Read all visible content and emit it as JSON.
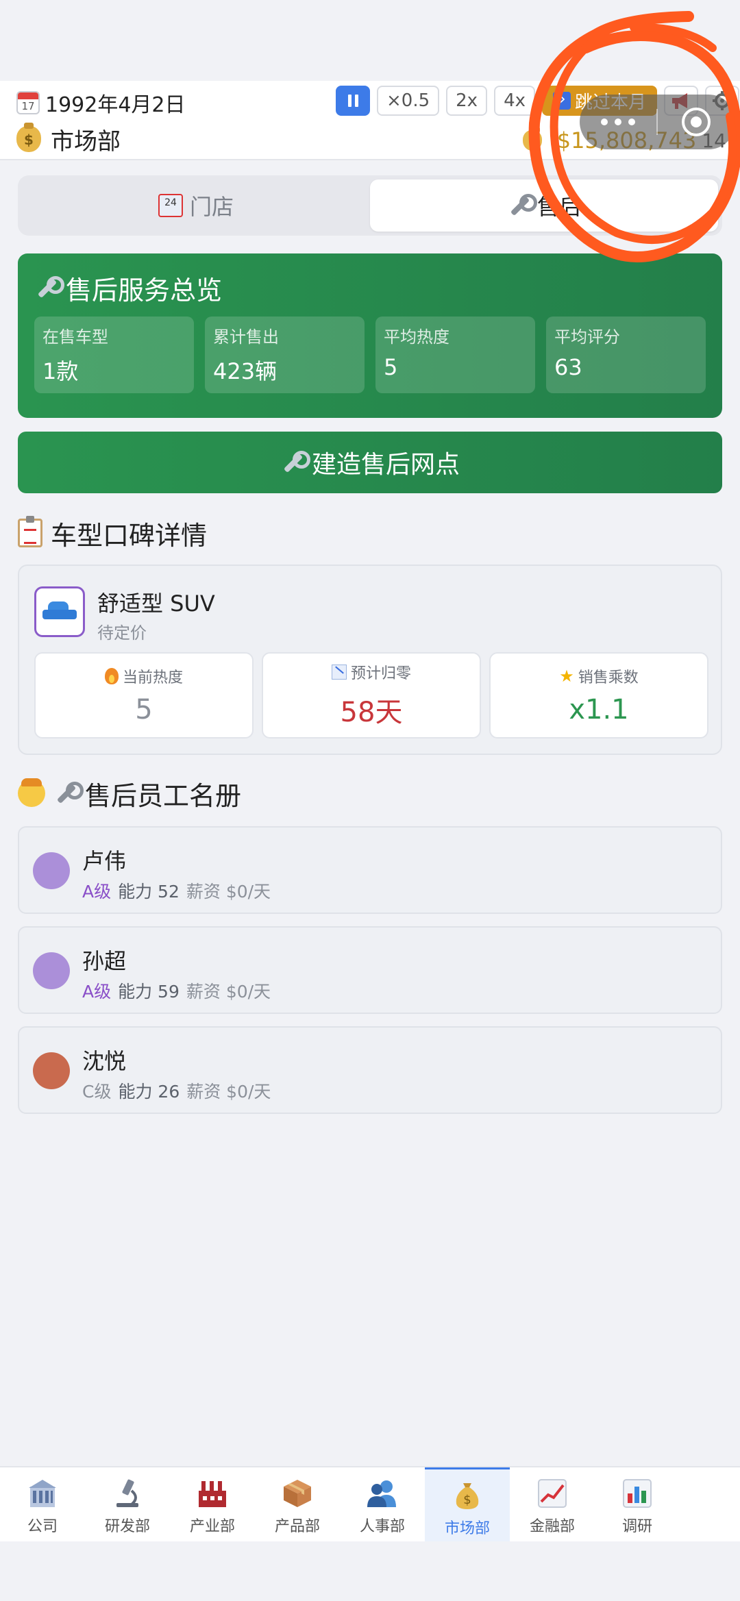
{
  "topbar": {
    "date_icon_text": "17",
    "date": "1992年4月2日",
    "speed_options": [
      "×0.5",
      "2x",
      "4x"
    ],
    "skip_label": "跳过本月",
    "department_title": "市场部",
    "money": "$15,808,743",
    "secondary_count": "14",
    "money_bag_symbol": "$"
  },
  "tabs": [
    {
      "label": "门店",
      "active": false
    },
    {
      "label": "售后",
      "active": true
    }
  ],
  "overview": {
    "title": "售后服务总览",
    "stats": [
      {
        "label": "在售车型",
        "value": "1款"
      },
      {
        "label": "累计售出",
        "value": "423辆"
      },
      {
        "label": "平均热度",
        "value": "5"
      },
      {
        "label": "平均评分",
        "value": "63"
      }
    ]
  },
  "build_button_label": "建造售后网点",
  "reputation": {
    "section_title": "车型口碑详情",
    "car": {
      "name": "舒适型 SUV",
      "price": "待定价",
      "stats": [
        {
          "label": "当前热度",
          "value": "5",
          "color": "#8b9099",
          "icon": "flame-icon"
        },
        {
          "label": "预计归零",
          "value": "58天",
          "color": "#c8363a",
          "icon": "chart-down-icon"
        },
        {
          "label": "销售乘数",
          "value": "x1.1",
          "color": "#2c9650",
          "icon": "star-icon"
        }
      ]
    }
  },
  "staff_section": {
    "title": "售后员工名册",
    "staff": [
      {
        "name": "卢伟",
        "grade": "A级",
        "ability": "能力 52",
        "salary": "薪资 $0/天",
        "avatar_color": "#ab8fd9"
      },
      {
        "name": "孙超",
        "grade": "A级",
        "ability": "能力 59",
        "salary": "薪资 $0/天",
        "avatar_color": "#ab8fd9"
      },
      {
        "name": "沈悦",
        "grade": "C级",
        "ability": "能力 26",
        "salary": "薪资 $0/天",
        "avatar_color": "#c96a4e"
      }
    ]
  },
  "bottom_nav": [
    {
      "label": "公司",
      "icon": "building-icon",
      "active": false
    },
    {
      "label": "研发部",
      "icon": "microscope-icon",
      "active": false
    },
    {
      "label": "产业部",
      "icon": "factory-icon",
      "active": false
    },
    {
      "label": "产品部",
      "icon": "package-icon",
      "active": false
    },
    {
      "label": "人事部",
      "icon": "people-icon",
      "active": false
    },
    {
      "label": "市场部",
      "icon": "money-bag-icon",
      "active": true
    },
    {
      "label": "金融部",
      "icon": "chart-up-icon",
      "active": false
    },
    {
      "label": "调研",
      "icon": "bar-chart-icon",
      "active": false
    }
  ],
  "colors": {
    "accent_blue": "#3d7be8",
    "green_card": "#2a9450",
    "gold_money": "#c8961c",
    "annotation_orange": "#ff5a1f"
  }
}
